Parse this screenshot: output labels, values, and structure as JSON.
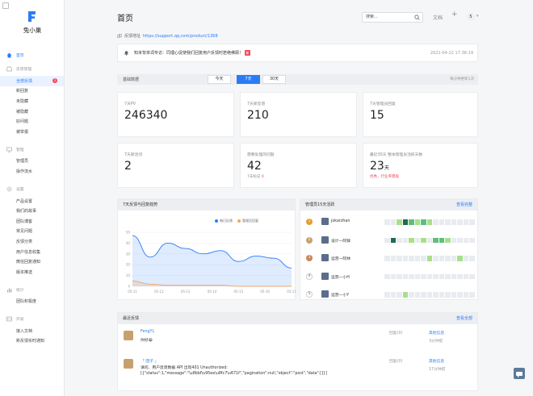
{
  "app": {
    "name": "兔小巢"
  },
  "sidebar": {
    "sections": [
      {
        "label": "首页",
        "icon": "home-icon",
        "items": []
      },
      {
        "label": "反馈管理",
        "icon": "inbox-icon",
        "items": [
          {
            "label": "全部反馈",
            "badge": "1",
            "active": true
          },
          {
            "label": "新回复"
          },
          {
            "label": "未隐藏"
          },
          {
            "label": "被隐藏"
          },
          {
            "label": "好问题"
          },
          {
            "label": "被举报"
          }
        ]
      },
      {
        "label": "管理",
        "icon": "monitor-icon",
        "items": [
          {
            "label": "管理员"
          },
          {
            "label": "操作流水"
          }
        ]
      },
      {
        "label": "设置",
        "icon": "gear-icon",
        "items": [
          {
            "label": "产品设置"
          },
          {
            "label": "我们的故事"
          },
          {
            "label": "团队博客"
          },
          {
            "label": "常见问题"
          },
          {
            "label": "反馈分类"
          },
          {
            "label": "用户信息收集"
          },
          {
            "label": "微信回复通知"
          },
          {
            "label": "版本推送"
          }
        ]
      },
      {
        "label": "统计",
        "icon": "chart-icon",
        "items": [
          {
            "label": "团队积极度"
          }
        ]
      },
      {
        "label": "开发",
        "icon": "code-icon",
        "items": [
          {
            "label": "接入文档"
          },
          {
            "label": "新反馈实时通知"
          }
        ]
      }
    ]
  },
  "header": {
    "title": "首页",
    "search_placeholder": "搜索...",
    "docs": "文档",
    "plus": "+",
    "avatar": "5"
  },
  "feedback_address": {
    "label": "反馈地址",
    "url": "https://support.qq.com/product/1368"
  },
  "notice": {
    "text": "知米背单词专访：同理心促使我们回复用户反馈时若绝佛顾！",
    "tag": "新",
    "time": "2021-04-22 17:38:19"
  },
  "filter": {
    "label": "基础数据",
    "options": [
      "今天",
      "7天",
      "30天"
    ],
    "selected": "7天",
    "update_note": "每分钟更新1次"
  },
  "stats": [
    {
      "label": "7天PV",
      "value": "246340",
      "sub": ""
    },
    {
      "label": "7天新反馈",
      "value": "210",
      "sub": ""
    },
    {
      "label": "7天管理员回复",
      "value": "15",
      "sub": ""
    },
    {
      "label": "7天新话问",
      "value": "2",
      "sub": ""
    },
    {
      "label": "需要处理的问题",
      "value": "42",
      "sub": "7天标记",
      "sub_value": "0"
    },
    {
      "label": "最近30天 整体管理员活跃天数",
      "value": "23",
      "unit": "天",
      "sub": "优秀，行业率需般"
    }
  ],
  "chart_panel": {
    "title": "7天反馈与回复趋势"
  },
  "chart_data": {
    "type": "area",
    "x": [
      "05-11",
      "05-12",
      "05-13",
      "05-14",
      "05-15",
      "05-16",
      "05-17"
    ],
    "series": [
      {
        "name": "每日反馈",
        "color": "#2a7cf6",
        "values": [
          47,
          27,
          40,
          35,
          30,
          33,
          23,
          28,
          26,
          17
        ]
      },
      {
        "name": "管理员回复",
        "color": "#f0a868",
        "values": [
          5,
          2,
          1,
          1,
          1,
          1,
          0,
          0,
          0,
          0
        ]
      }
    ],
    "ylim": [
      0,
      50
    ],
    "yticks": [
      0,
      10,
      20,
      30,
      40,
      50
    ],
    "grid": true,
    "legend": "top-right"
  },
  "ranking": {
    "title": "管理员15天活跃",
    "more": "查看完整",
    "rows": [
      {
        "rank": "1",
        "rank_color": "#e0a030",
        "name": "jokarzhan",
        "cells": [
          0,
          0,
          1,
          3,
          2,
          1,
          2,
          1,
          0,
          0,
          0,
          0,
          0,
          0,
          0
        ]
      },
      {
        "rank": "2",
        "rank_color": "#c8a070",
        "name": "设计—阿锋",
        "cells": [
          0,
          3,
          0,
          0,
          1,
          0,
          1,
          0,
          2,
          2,
          1,
          0,
          0,
          0,
          0
        ]
      },
      {
        "rank": "3",
        "rank_color": "#c88858",
        "name": "运营—阿林",
        "cells": [
          0,
          0,
          0,
          0,
          0,
          0,
          0,
          1,
          0,
          0,
          0,
          0,
          1,
          0,
          0
        ]
      },
      {
        "rank": "4",
        "rank_color": "",
        "name": "运营—小H",
        "cells": [
          0,
          0,
          0,
          0,
          0,
          0,
          0,
          0,
          0,
          0,
          0,
          0,
          0,
          0,
          0
        ]
      },
      {
        "rank": "5",
        "rank_color": "",
        "name": "运营—小Y",
        "cells": [
          0,
          0,
          0,
          1,
          0,
          0,
          0,
          0,
          0,
          0,
          0,
          0,
          0,
          0,
          0
        ]
      }
    ]
  },
  "recent": {
    "title": "最近反馈",
    "more": "查看全部",
    "items": [
      {
        "name": "FengYL",
        "content": "你好😀",
        "status": "回复(0)",
        "link": "其他信息",
        "time": "3分钟前"
      },
      {
        "name": "「 团子 」",
        "content": "请问、用户反馈数据 API 出现401 Unauthorized: [{\"status\":1,\"message\":\"\\u8bbf\\u95ee\\u8fc7\\u671f\",\"pagination\":null,\"object\":\"post\",\"data\":[]}]",
        "status": "回复(0)",
        "link": "其他信息",
        "time": "17分钟前"
      }
    ]
  }
}
